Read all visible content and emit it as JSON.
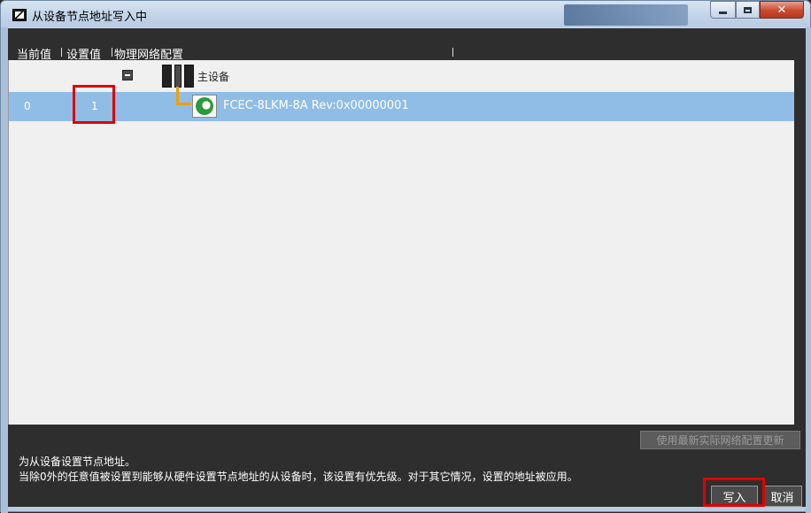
{
  "window": {
    "title": "从设备节点地址写入中"
  },
  "columns": {
    "current": "当前值",
    "set": "设置值",
    "physical": "物理网络配置"
  },
  "tree": {
    "master_label": "主设备",
    "device": {
      "current_value": "0",
      "set_value": "1",
      "name": "FCEC-8LKM-8A Rev:0x00000001"
    }
  },
  "footer": {
    "update_button": "使用最新实际网络配置更新",
    "description_title": "为从设备设置节点地址。",
    "description_body": "当除0外的任意值被设置到能够从硬件设置节点地址的从设备时，该设置有优先级。对于其它情况，设置的地址被应用。",
    "write_button": "写入",
    "cancel_button": "取消"
  },
  "colors": {
    "selection": "#8fbde6",
    "highlight": "#e00000",
    "tree_line": "#f0a000"
  }
}
